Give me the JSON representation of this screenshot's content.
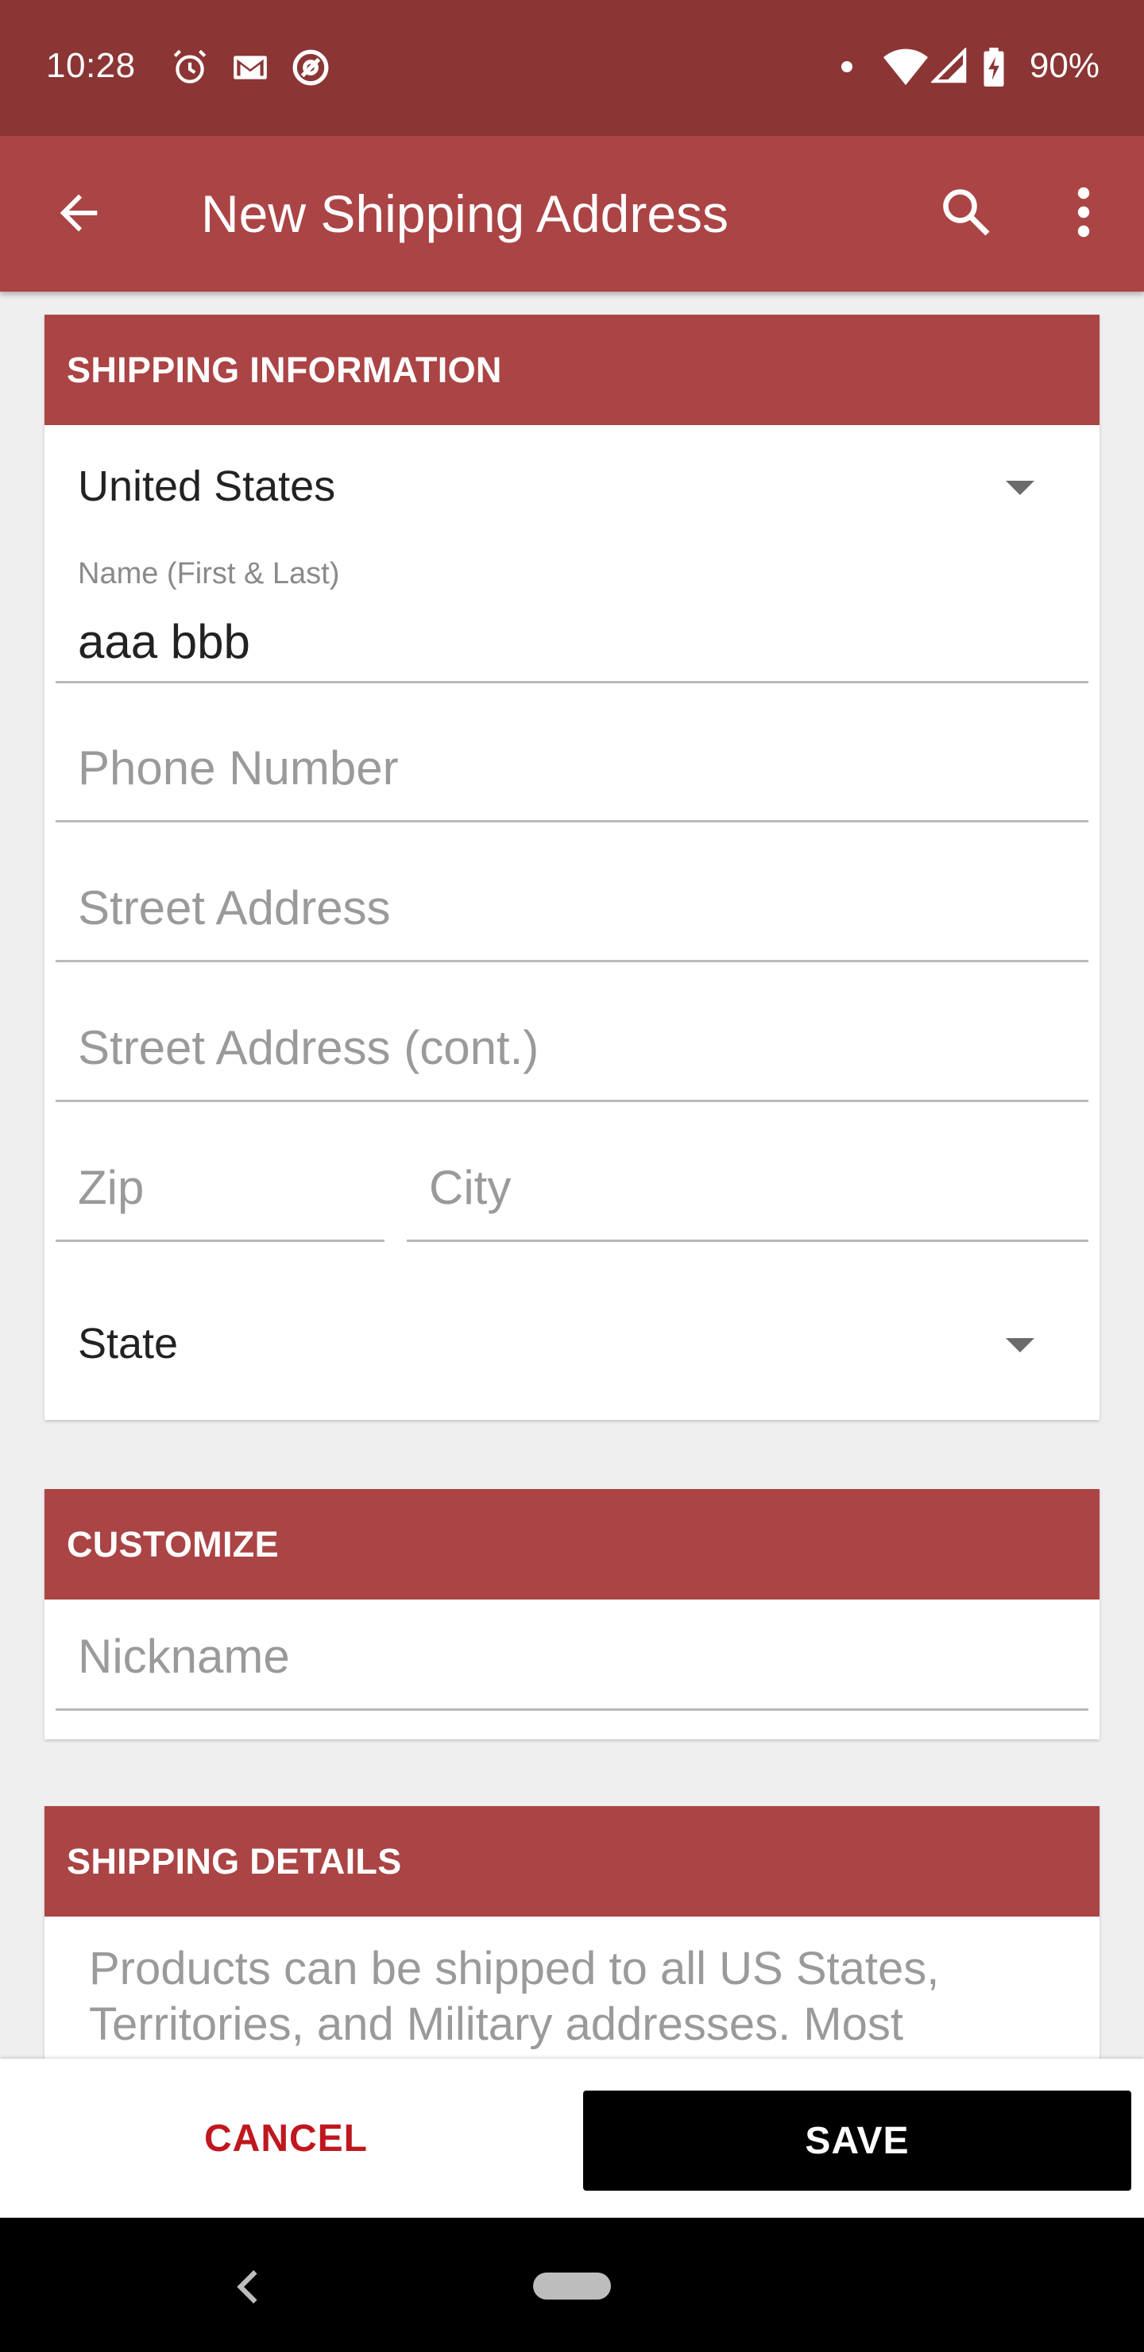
{
  "status_bar": {
    "time": "10:28",
    "battery": "90%",
    "icons": [
      "alarm-icon",
      "gmail-icon",
      "at-sign-icon",
      "dot-icon",
      "wifi-icon",
      "signal-icon",
      "battery-icon"
    ]
  },
  "app_bar": {
    "title": "New Shipping Address",
    "icons": [
      "back-arrow-icon",
      "search-icon",
      "more-vert-icon"
    ],
    "color": "#ab4445"
  },
  "shipping_info": {
    "header": "SHIPPING INFORMATION",
    "country": "United States",
    "name_label": "Name (First & Last)",
    "name_value": "aaa bbb",
    "phone_placeholder": "Phone Number",
    "street_placeholder": "Street Address",
    "street2_placeholder": "Street Address (cont.)",
    "zip_placeholder": "Zip",
    "city_placeholder": "City",
    "state": "State"
  },
  "customize": {
    "header": "CUSTOMIZE",
    "nickname_placeholder": "Nickname"
  },
  "shipping_details": {
    "header": "SHIPPING DETAILS",
    "text": "Products can be shipped to all US States, Territories, and Military addresses. Most"
  },
  "actions": {
    "cancel": "CANCEL",
    "save": "SAVE",
    "cancel_color": "#c0171f"
  }
}
